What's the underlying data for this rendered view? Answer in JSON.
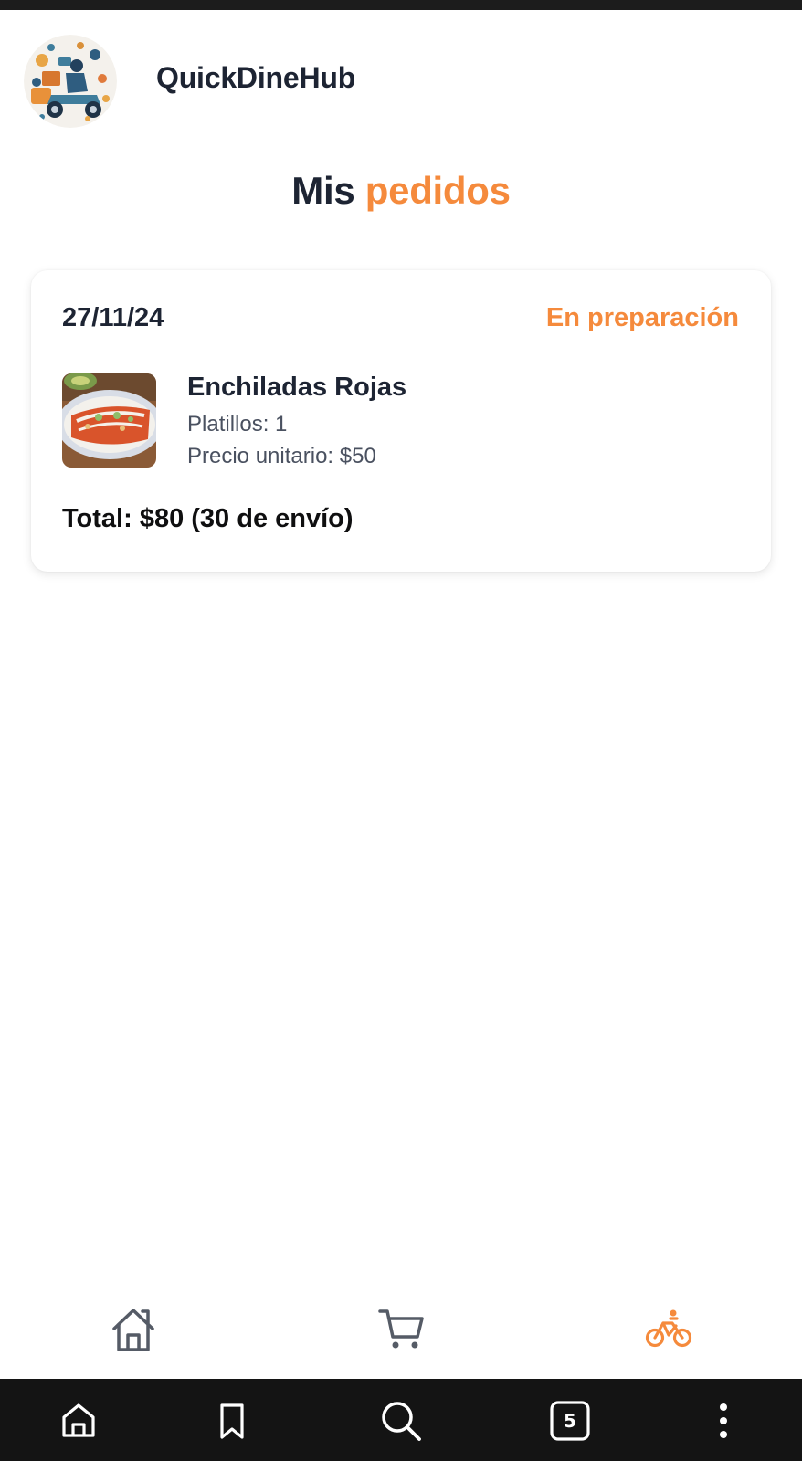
{
  "app": {
    "name": "QuickDineHub"
  },
  "page": {
    "title_part1": "Mis",
    "title_part2": "pedidos"
  },
  "orders": [
    {
      "date": "27/11/24",
      "status": "En preparación",
      "item": {
        "name": "Enchiladas Rojas",
        "quantity": "Platillos: 1",
        "unit_price": "Precio unitario: $50"
      },
      "total": "Total: $80 (30 de envío)"
    }
  ],
  "bottom_nav": {
    "items": [
      {
        "icon": "home-icon",
        "active": false
      },
      {
        "icon": "cart-icon",
        "active": false
      },
      {
        "icon": "bike-icon",
        "active": true
      }
    ]
  },
  "browser_bar": {
    "tab_count": "5"
  },
  "colors": {
    "accent": "#f58a3c",
    "text_dark": "#1d2433",
    "nav_icon": "#555b66",
    "browser_bar": "#141414"
  }
}
